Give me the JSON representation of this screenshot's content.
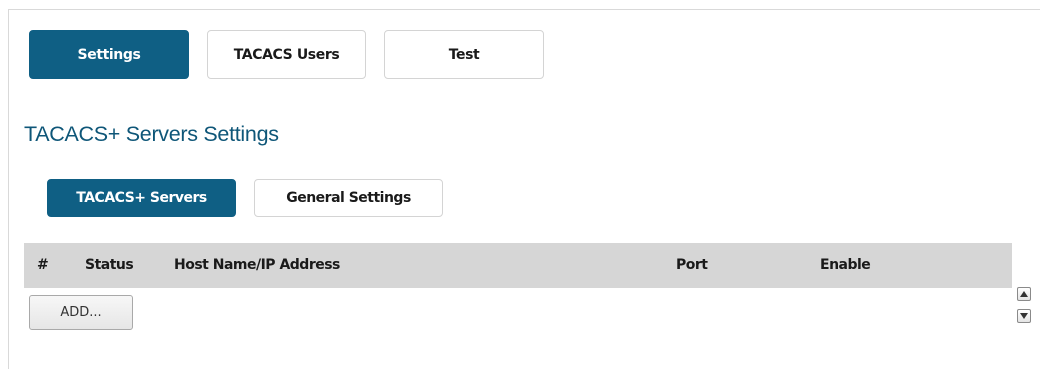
{
  "tabs": {
    "settings": "Settings",
    "tacacs_users": "TACACS Users",
    "test": "Test"
  },
  "section": {
    "title": "TACACS+ Servers Settings"
  },
  "subtabs": {
    "servers": "TACACS+ Servers",
    "general": "General Settings"
  },
  "table": {
    "columns": [
      "#",
      "Status",
      "Host Name/IP Address",
      "Port",
      "Enable"
    ]
  },
  "actions": {
    "add_label": "ADD..."
  },
  "icons": {
    "scroll_up": "triangle-up-icon",
    "scroll_down": "triangle-down-icon"
  },
  "colors": {
    "accent": "#0f5f84",
    "title": "#0e5678",
    "table_header_bg": "#d6d6d6"
  }
}
